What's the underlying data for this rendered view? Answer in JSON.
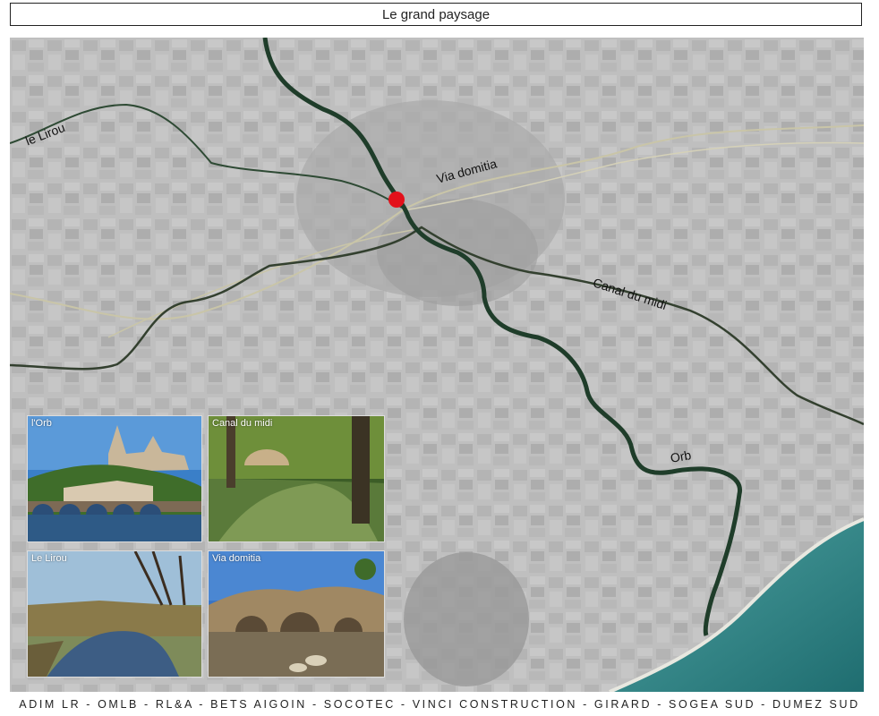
{
  "title": "Le grand paysage",
  "map": {
    "labels": {
      "lirou": "le Lirou",
      "via_domitia": "Via domitia",
      "canal_du_midi": "Canal du midi",
      "orb": "Orb"
    },
    "colors": {
      "river": "#1f3d2a",
      "canal": "#2e3b2c",
      "road": "#c9c5a8",
      "marker": "#e3101a",
      "sea": "#2c7f80",
      "land": "#bdbdbd"
    }
  },
  "photos": {
    "orb": "l'Orb",
    "canal_du_midi": "Canal du midi",
    "le_lirou": "Le Lirou",
    "via_domitia": "Via domitia"
  },
  "footer": "ADIM LR - OMLB - RL&A - BETS AIGOIN - SOCOTEC - VINCI CONSTRUCTION - GIRARD - SOGEA SUD - DUMEZ SUD"
}
